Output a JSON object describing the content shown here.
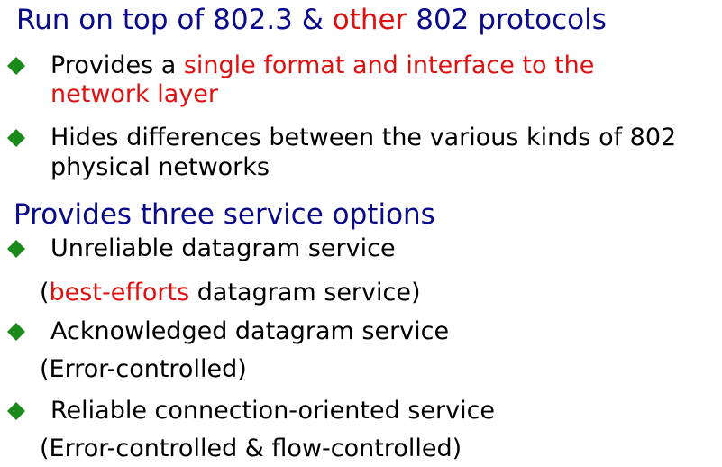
{
  "heading1": {
    "part1": "Run on top of 802.3 & ",
    "part2_red": "other",
    "part3": " 802 protocols"
  },
  "bullet1": {
    "line1_part1": "Provides a ",
    "line1_part2_red": "single format and interface to the",
    "line2_red": "network layer"
  },
  "bullet2": {
    "line1": "Hides differences between the various kinds of 802",
    "line2": "physical networks"
  },
  "heading2": {
    "text": "Provides three service options"
  },
  "bullet3": {
    "line1": "Unreliable datagram service",
    "line2_part1": "(",
    "line2_part2_red": "best-efforts",
    "line2_part3": " datagram service)"
  },
  "bullet4": {
    "line1": "Acknowledged datagram service",
    "line2": "(Error-controlled)"
  },
  "bullet5": {
    "line1": "Reliable connection-oriented service",
    "line2": "(Error-controlled &  flow-controlled)"
  },
  "colors": {
    "heading": "#0a0a8c",
    "highlight": "#e01010",
    "bullet": "#1a8a1a",
    "body_text": "#000000"
  },
  "icons": {
    "bullet": "green-diamond-icon"
  }
}
